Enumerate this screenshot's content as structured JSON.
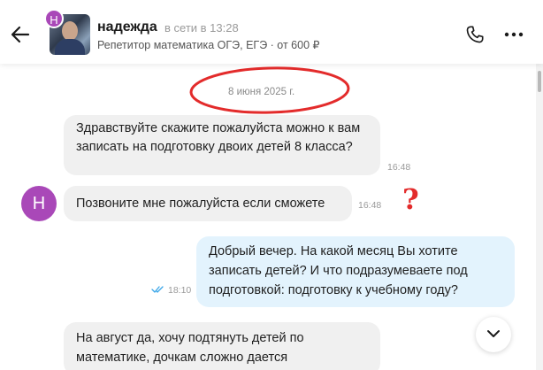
{
  "header": {
    "avatar_letter": "Н",
    "name": "надежда",
    "status": "в сети в 13:28",
    "subtitle": "Репетитор математика ОГЭ, ЕГЭ · от 600 ₽"
  },
  "chat": {
    "date": "8 июня 2025 г.",
    "avatar_letter": "Н",
    "annotation_mark": "?",
    "messages": [
      {
        "text": "Здравствуйте скажите пожалуйста можно к вам записать  на подготовку двоих детей 8 класса?",
        "time": "16:48"
      },
      {
        "text": "Позвоните мне пожалуйста если сможете",
        "time": "16:48"
      },
      {
        "text": "Добрый вечер. На какой месяц Вы хотите записать детей? И что подразумеваете под подготовкой: подготовку к учебному году?",
        "time": "18:10"
      },
      {
        "text": "На август да, хочу подтянуть детей по математике, дочкам сложно дается",
        "time": ""
      }
    ]
  },
  "colors": {
    "accent": "#a948b8",
    "incoming_bubble": "#f0f0f0",
    "outgoing_bubble": "#e3f3fd",
    "annotation": "#e32b2b",
    "read_check": "#3aa6e8"
  },
  "icons": {
    "back": "arrow-left-icon",
    "phone": "phone-icon",
    "more": "more-dots-icon",
    "read": "double-check-icon",
    "scroll_down": "chevron-down-icon"
  }
}
